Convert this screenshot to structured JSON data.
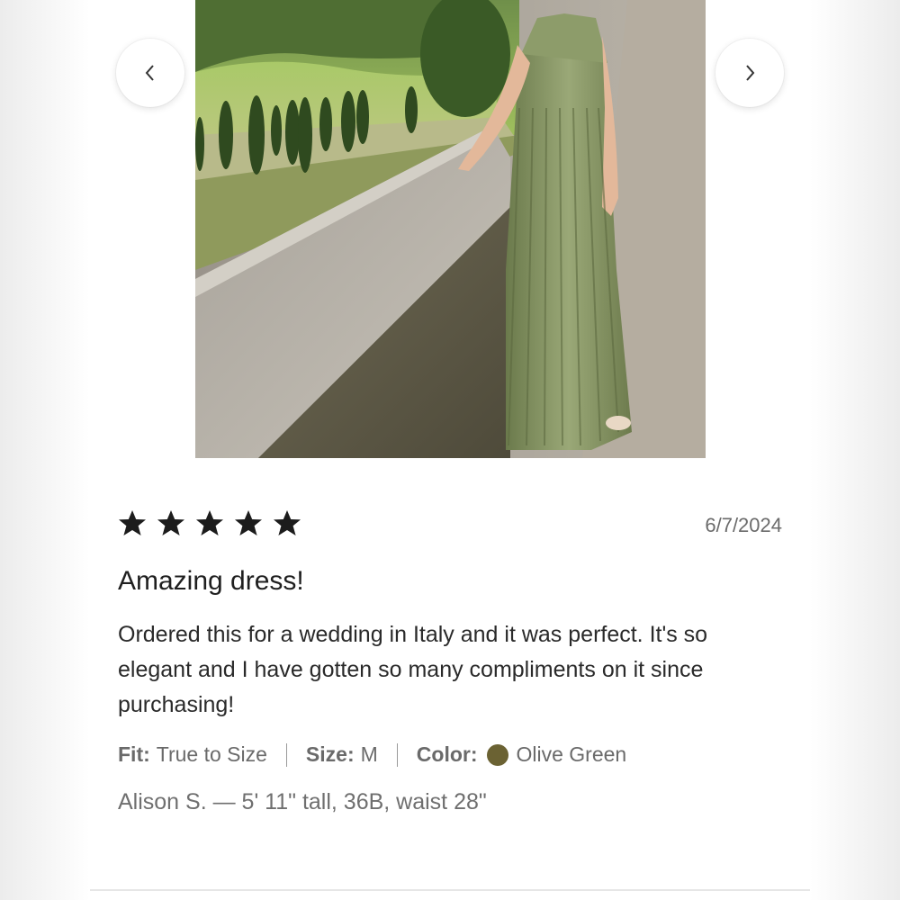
{
  "carousel": {
    "prev_icon": "chevron-left-icon",
    "next_icon": "chevron-right-icon"
  },
  "review": {
    "rating": 5,
    "rating_max": 5,
    "star_icon": "star-filled-icon",
    "star_color": "#1c1c1c",
    "date": "6/7/2024",
    "title": "Amazing dress!",
    "body": "Ordered this for a wedding in Italy and it was perfect. It's so elegant and I have gotten so many compliments on it since purchasing!",
    "fit_label": "Fit:",
    "fit_value": "True to Size",
    "size_label": "Size:",
    "size_value": "M",
    "color_label": "Color:",
    "color_value": "Olive Green",
    "color_swatch": "#6b6233",
    "reviewer": "Alison S. — 5' 11\" tall, 36B, waist 28\""
  }
}
